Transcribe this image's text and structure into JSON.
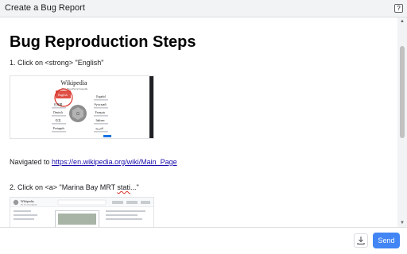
{
  "window": {
    "title": "Create a Bug Report",
    "help_label": "?"
  },
  "report": {
    "heading": "Bug Reproduction Steps",
    "step1_text": "1. Click on <strong> \"English\"",
    "wiki_title": "Wikipedia",
    "wiki_subtitle": "The Free Encyclopedia",
    "wiki_languages": [
      "English",
      "Español",
      "日本語",
      "Deutsch",
      "Русский",
      "Français",
      "中文",
      "Italiano",
      "Português",
      "العربية"
    ],
    "nav_prefix": "Navigated to ",
    "nav_url": "https://en.wikipedia.org/wiki/Main_Page",
    "step2_prefix": "2. Click on <a> \"Marina Bay MRT ",
    "step2_misspelled": "stati",
    "step2_suffix": "...\"",
    "shot2_title": "Wikipedia",
    "shot2_subtitle": "The Free Encyclopedia"
  },
  "footer": {
    "send_label": "Send",
    "download_icon": "download-icon"
  },
  "colors": {
    "accent": "#4285f4",
    "link": "#1a0dab",
    "highlight": "#d93025"
  }
}
